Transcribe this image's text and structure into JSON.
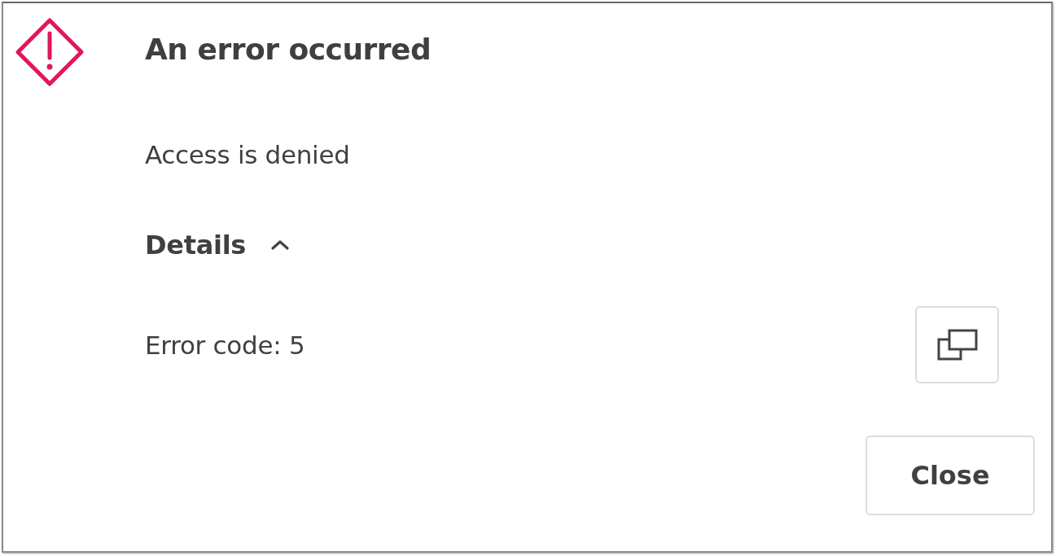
{
  "dialog": {
    "title": "An error occurred",
    "message": "Access is denied",
    "details": {
      "label": "Details",
      "expanded": true,
      "error_code": "Error code: 5"
    },
    "buttons": [
      "Close"
    ]
  }
}
